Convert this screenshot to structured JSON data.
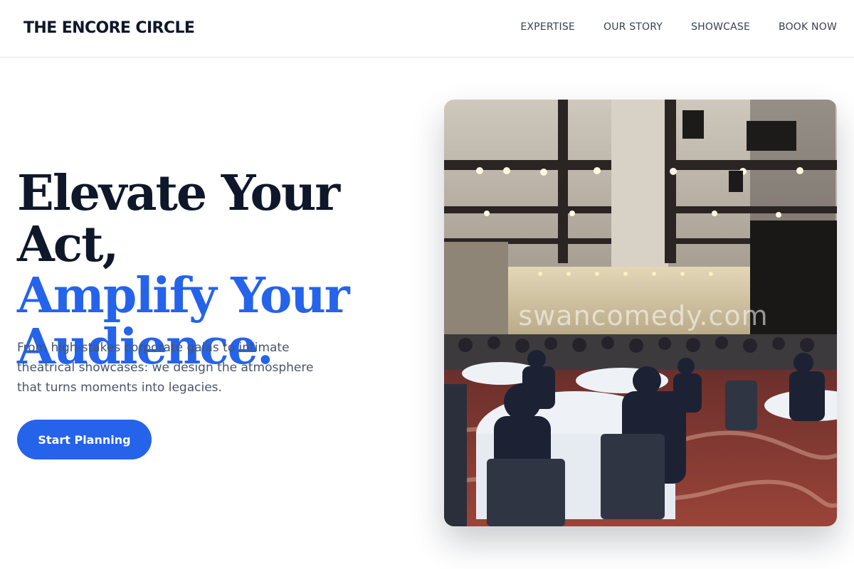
{
  "brand": {
    "name": "THE ENCORE CIRCLE"
  },
  "nav": {
    "items": [
      {
        "label": "EXPERTISE"
      },
      {
        "label": "OUR STORY"
      },
      {
        "label": "SHOWCASE"
      },
      {
        "label": "BOOK NOW"
      }
    ]
  },
  "hero": {
    "heading_line1": "Elevate Your Act,",
    "heading_line2": "Amplify Your",
    "heading_line3": "Audience.",
    "subtitle": "From high-stakes corporate galas to intimate theatrical showcases: we design the atmosphere that turns moments into legacies.",
    "cta_label": "Start Planning"
  },
  "photo": {
    "subject": "ballroom-gala-dinner-photo",
    "watermark": "swancomedy.com"
  },
  "colors": {
    "accent": "#2563eb",
    "heading_dark": "#0f172a",
    "body_text": "#475569",
    "border": "#e5e7eb"
  }
}
